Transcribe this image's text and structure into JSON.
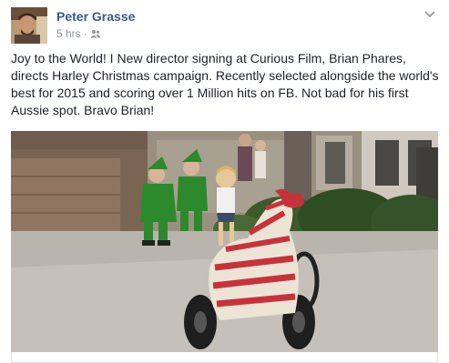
{
  "post": {
    "author": "Peter Grasse",
    "timestamp": "5 hrs",
    "separator": "·",
    "audience_icon": "friends-icon",
    "options_icon": "chevron-down-icon",
    "text": "Joy to the World! I New director signing at Curious Film, Brian Phares, directs Harley Christmas campaign. Recently selected alongside the world's best for 2015 and scoring over 1 Million hits on FB. Not bad for his first Aussie spot. Bravo Brian!"
  },
  "colors": {
    "author_link": "#365899",
    "meta_text": "#90949c",
    "body_text": "#1d2129"
  }
}
